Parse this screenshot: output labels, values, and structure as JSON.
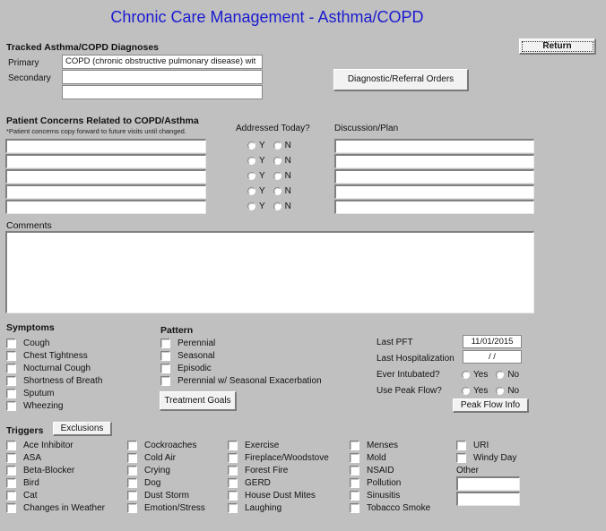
{
  "title": "Chronic Care Management - Asthma/COPD",
  "return_button": "Return",
  "diagnoses": {
    "heading": "Tracked Asthma/COPD Diagnoses",
    "primary_label": "Primary",
    "primary_value": "COPD (chronic obstructive pulmonary disease) wit",
    "secondary_label": "Secondary",
    "secondary_value": "",
    "tertiary_value": "",
    "orders_button": "Diagnostic/Referral Orders"
  },
  "concerns": {
    "heading": "Patient Concerns Related to COPD/Asthma",
    "note": "*Patient concerns copy forward to future visits until changed.",
    "addressed_heading": "Addressed Today?",
    "discussion_heading": "Discussion/Plan",
    "yes_label": "Y",
    "no_label": "N",
    "rows": [
      {
        "concern": "",
        "addressed": null,
        "discussion": ""
      },
      {
        "concern": "",
        "addressed": null,
        "discussion": ""
      },
      {
        "concern": "",
        "addressed": null,
        "discussion": ""
      },
      {
        "concern": "",
        "addressed": null,
        "discussion": ""
      },
      {
        "concern": "",
        "addressed": null,
        "discussion": ""
      }
    ]
  },
  "comments": {
    "heading": "Comments",
    "value": ""
  },
  "symptoms": {
    "heading": "Symptoms",
    "items": [
      "Cough",
      "Chest Tightness",
      "Nocturnal Cough",
      "Shortness of Breath",
      "Sputum",
      "Wheezing"
    ]
  },
  "pattern": {
    "heading": "Pattern",
    "items": [
      "Perennial",
      "Seasonal",
      "Episodic",
      "Perennial w/ Seasonal Exacerbation"
    ],
    "treatment_goals_button": "Treatment Goals"
  },
  "history": {
    "last_pft_label": "Last PFT",
    "last_pft_value": "11/01/2015",
    "last_hosp_label": "Last Hospitalization",
    "last_hosp_value": " / /",
    "intubated_label": "Ever Intubated?",
    "peak_flow_label": "Use Peak Flow?",
    "yes_label": "Yes",
    "no_label": "No",
    "peak_flow_button": "Peak Flow Info"
  },
  "triggers": {
    "heading": "Triggers",
    "exclusions_button": "Exclusions",
    "columns": [
      [
        "Ace Inhibitor",
        "ASA",
        "Beta-Blocker",
        "Bird",
        "Cat",
        "Changes in Weather"
      ],
      [
        "Cockroaches",
        "Cold Air",
        "Crying",
        "Dog",
        "Dust Storm",
        "Emotion/Stress"
      ],
      [
        "Exercise",
        "Fireplace/Woodstove",
        "Forest Fire",
        "GERD",
        "House Dust Mites",
        "Laughing"
      ],
      [
        "Menses",
        "Mold",
        "NSAID",
        "Pollution",
        "Sinusitis",
        "Tobacco Smoke"
      ],
      [
        "URI",
        "Windy Day"
      ]
    ],
    "other_label": "Other",
    "other_values": [
      "",
      ""
    ]
  }
}
